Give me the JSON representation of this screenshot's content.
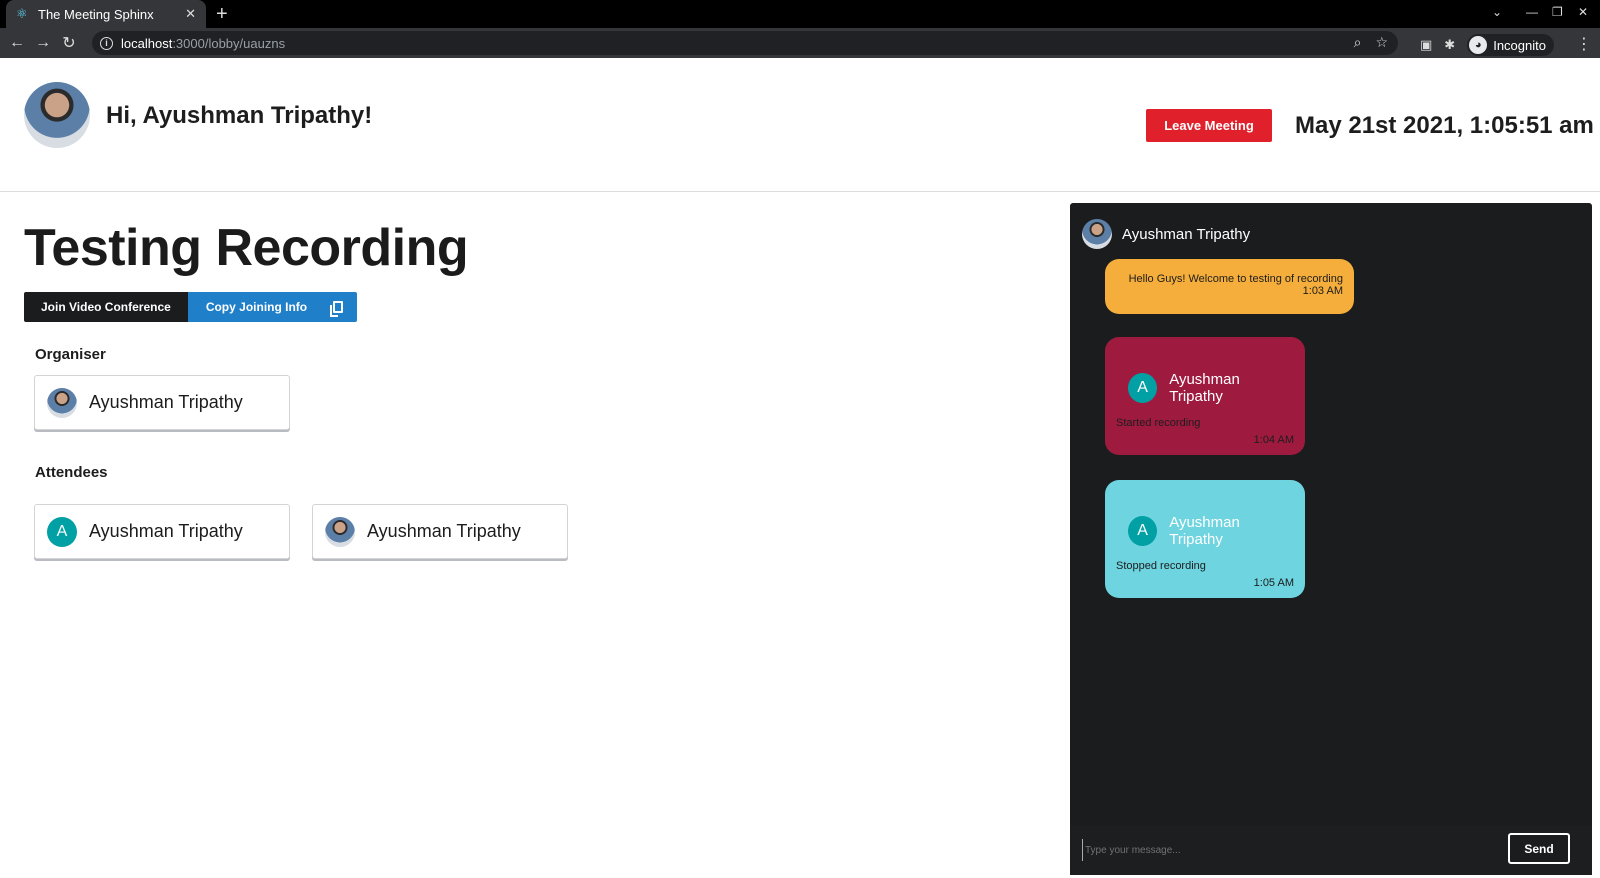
{
  "browser": {
    "tab_title": "The Meeting Sphinx",
    "url_host": "localhost",
    "url_path": ":3000/lobby/uauzns",
    "profile_label": "Incognito"
  },
  "header": {
    "greeting": "Hi, Ayushman Tripathy!",
    "leave_label": "Leave Meeting",
    "datetime": "May 21st 2021, 1:05:51 am"
  },
  "meeting": {
    "title": "Testing Recording",
    "join_label": "Join Video Conference",
    "copy_label": "Copy Joining Info",
    "organiser_heading": "Organiser",
    "organiser": {
      "name": "Ayushman Tripathy"
    },
    "attendees_heading": "Attendees",
    "attendees": [
      {
        "name": "Ayushman Tripathy",
        "initial": "A"
      },
      {
        "name": "Ayushman Tripathy"
      }
    ]
  },
  "chat": {
    "user_name": "Ayushman Tripathy",
    "messages": [
      {
        "text": "Hello Guys! Welcome to testing of recording",
        "time": "1:03 AM"
      },
      {
        "initial": "A",
        "name": "Ayushman Tripathy",
        "text": "Started recording",
        "time": "1:04 AM"
      },
      {
        "initial": "A",
        "name": "Ayushman Tripathy",
        "text": "Stopped recording",
        "time": "1:05 AM"
      }
    ],
    "input_placeholder": "Type your message...",
    "send_label": "Send"
  },
  "colors": {
    "leave": "#e0202a",
    "copy": "#1f7fc8",
    "msg_yellow": "#f5ae3b",
    "msg_red": "#9e1b3f",
    "msg_cyan": "#6dd4e0",
    "avatar_teal": "#00a0a5"
  }
}
